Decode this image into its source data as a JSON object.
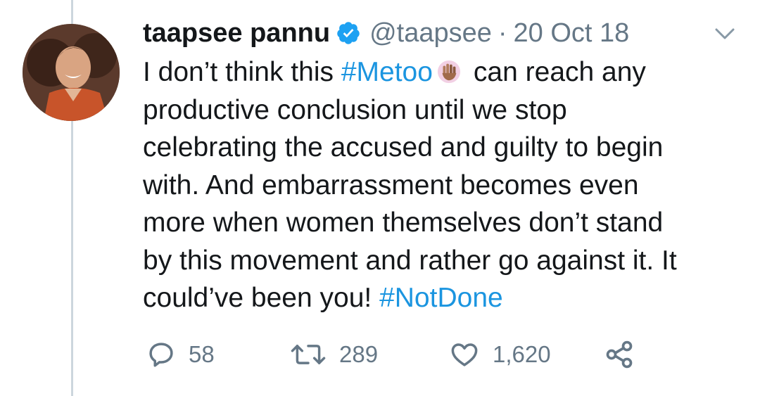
{
  "tweet": {
    "display_name": "taapsee pannu",
    "handle": "@taapsee",
    "separator": "·",
    "date": "20 Oct 18",
    "verified": true,
    "text_lines": [
      {
        "segments": [
          {
            "text": "I don’t think this ",
            "type": "text"
          },
          {
            "text": "#Metoo",
            "type": "hashtag"
          },
          {
            "text": "raised-hand-emoji",
            "type": "emoji"
          },
          {
            "text": "can reach any",
            "type": "text"
          }
        ]
      },
      {
        "segments": [
          {
            "text": "productive conclusion until we stop",
            "type": "text"
          }
        ]
      },
      {
        "segments": [
          {
            "text": "celebrating the accused and guilty to begin",
            "type": "text"
          }
        ]
      },
      {
        "segments": [
          {
            "text": "with. And embarrassment becomes even",
            "type": "text"
          }
        ]
      },
      {
        "segments": [
          {
            "text": "more when women themselves don’t stand",
            "type": "text"
          }
        ]
      },
      {
        "segments": [
          {
            "text": "by this movement and rather go against it. It",
            "type": "text"
          }
        ]
      },
      {
        "segments": [
          {
            "text": "could’ve been you! ",
            "type": "text"
          },
          {
            "text": "#NotDone",
            "type": "hashtag"
          }
        ]
      }
    ]
  },
  "actions": {
    "reply_count": "58",
    "retweet_count": "289",
    "like_count": "1,620"
  },
  "icons": {
    "reply": "speech-bubble-icon",
    "retweet": "retweet-arrows-icon",
    "like": "heart-icon",
    "share": "share-nodes-icon",
    "caret": "chevron-down-icon",
    "verified": "verified-badge-icon"
  },
  "colors": {
    "text": "#14171a",
    "muted": "#657786",
    "link": "#1b95e0",
    "verified": "#1da1f2",
    "thread_line": "#ccd6dd"
  }
}
